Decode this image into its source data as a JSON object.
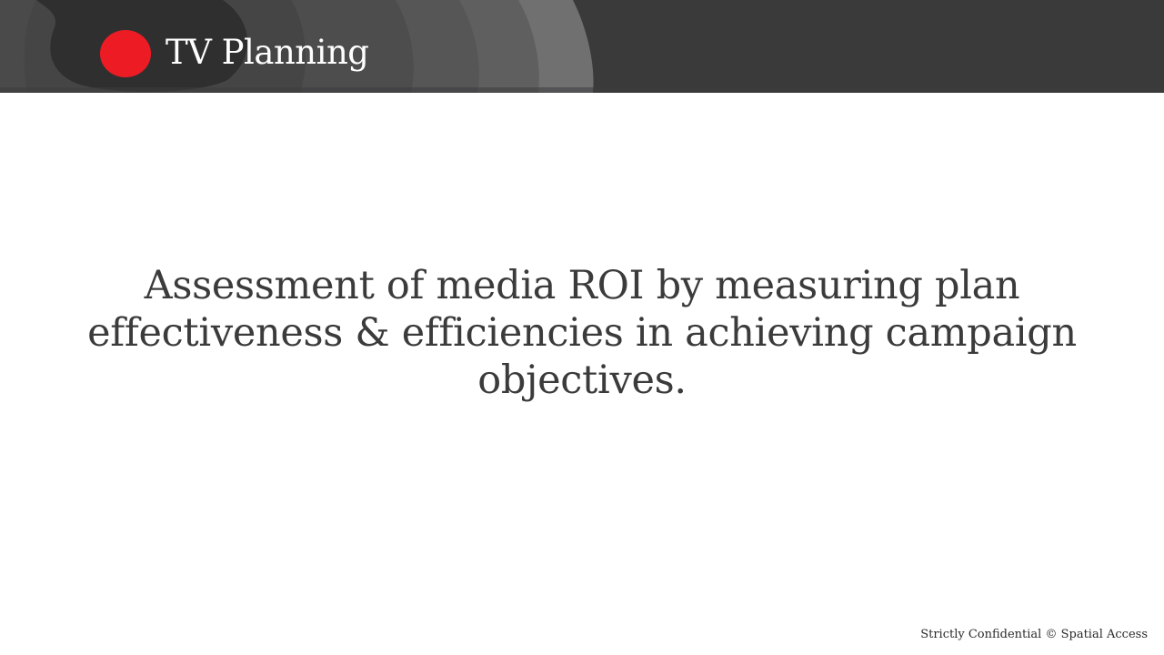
{
  "header": {
    "title": "TV Planning",
    "band_color": "#3a3a3b",
    "logo_color": "#ed1c24"
  },
  "main": {
    "statement": "Assessment of media ROI by measuring plan effectiveness & efficiencies in achieving campaign objectives."
  },
  "footer": {
    "note": "Strictly Confidential © Spatial Access"
  }
}
